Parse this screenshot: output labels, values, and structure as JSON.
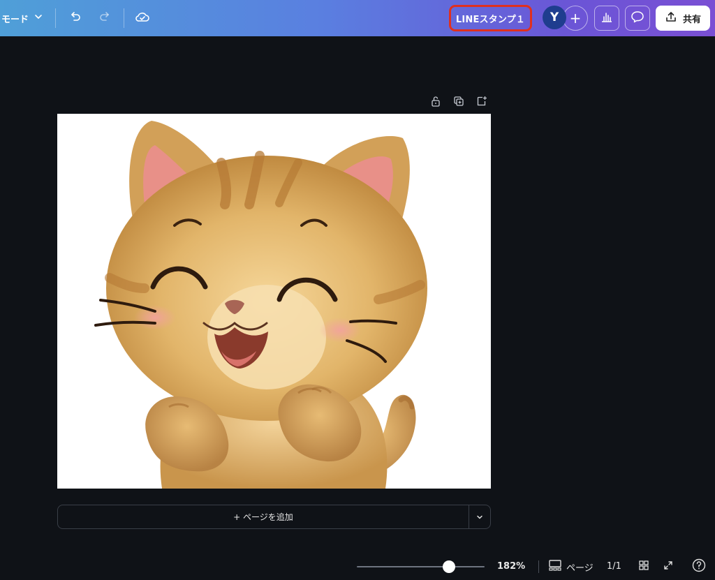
{
  "topbar": {
    "mode_label": "モード",
    "title": "LINEスタンプ１",
    "avatar_initial": "Y",
    "share_label": "共有",
    "gradient_start": "#4f9fd8",
    "gradient_end": "#7a4fd4",
    "highlight_color": "#e0301e"
  },
  "canvas": {
    "image_alt": "illustration of a smiling orange tabby kitten with paws raised",
    "background": "#ffffff"
  },
  "add_page": {
    "label": "+ ページを追加"
  },
  "bottombar": {
    "zoom": "182%",
    "zoom_fraction": 0.72,
    "pages_label": "ページ",
    "page_count": "1/1"
  }
}
